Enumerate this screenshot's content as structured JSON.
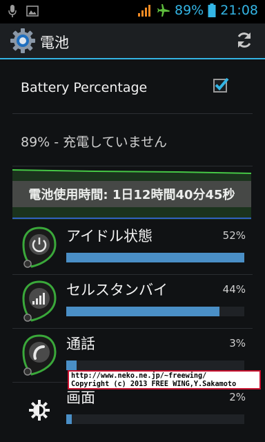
{
  "status_bar": {
    "battery_level": "89%",
    "time": "21:08"
  },
  "action_bar": {
    "title": "電池"
  },
  "battery_percentage": {
    "label": "Battery Percentage",
    "checked": true
  },
  "charge_status": "89% - 充電していません",
  "graph": {
    "usage_time": "電池使用時間: 1日12時間40分45秒"
  },
  "usage_items": [
    {
      "label": "アイドル状態",
      "percent": "52%",
      "level": 1.0,
      "icon": "idle-power-icon"
    },
    {
      "label": "セルスタンバイ",
      "percent": "44%",
      "level": 0.86,
      "icon": "cell-standby-icon"
    },
    {
      "label": "通話",
      "percent": "3%",
      "level": 0.06,
      "icon": "phone-call-icon"
    },
    {
      "label": "画面",
      "percent": "2%",
      "level": 0.03,
      "icon": "screen-brightness-icon"
    }
  ],
  "copyright": {
    "line1": "http://www.neko.ne.jp/~freewing/",
    "line2": "Copyright (c) 2013 FREE WING,Y.Sakamoto"
  }
}
